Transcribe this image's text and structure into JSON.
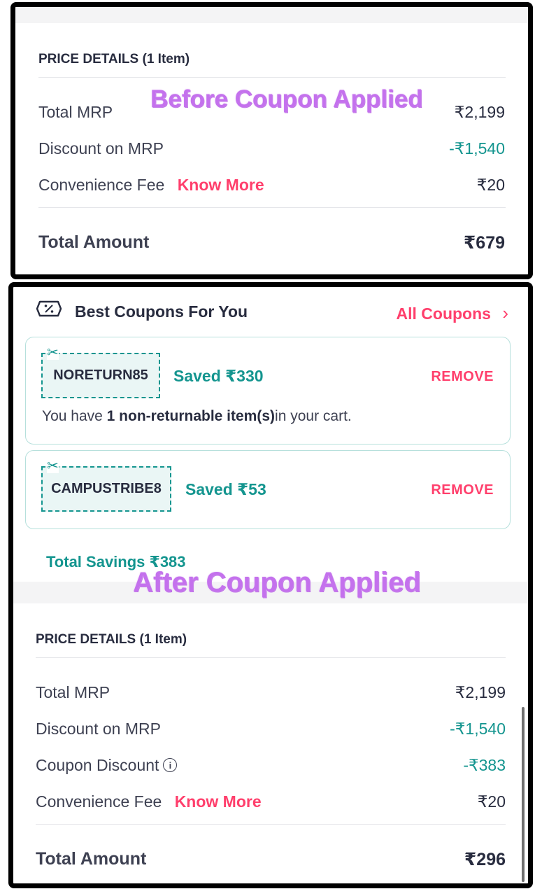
{
  "before": {
    "overlay": "Before Coupon Applied",
    "title": "PRICE DETAILS (1 Item)",
    "rows": [
      {
        "label": "Total MRP",
        "value": "₹2,199"
      },
      {
        "label": "Discount on MRP",
        "value": "-₹1,540"
      },
      {
        "label": "Convenience Fee",
        "link": "Know More",
        "value": "₹20"
      }
    ],
    "total_label": "Total Amount",
    "total_value": "₹679"
  },
  "coupons": {
    "header": "Best Coupons For You",
    "all_link": "All Coupons",
    "items": [
      {
        "code": "NORETURN85",
        "saved": "Saved ₹330",
        "action": "REMOVE",
        "note_pre": "You have ",
        "note_bold": "1 non-returnable item(s)",
        "note_post": "in your cart."
      },
      {
        "code": "CAMPUSTRIBE8",
        "saved": "Saved ₹53",
        "action": "REMOVE"
      }
    ],
    "total_savings": "Total Savings ₹383"
  },
  "after": {
    "overlay": "After Coupon Applied",
    "title": "PRICE DETAILS (1 Item)",
    "rows": [
      {
        "label": "Total MRP",
        "value": "₹2,199"
      },
      {
        "label": "Discount on MRP",
        "value": "-₹1,540"
      },
      {
        "label": "Coupon Discount",
        "value": "-₹383"
      },
      {
        "label": "Convenience Fee",
        "link": "Know More",
        "value": "₹20"
      }
    ],
    "total_label": "Total Amount",
    "total_value": "₹296"
  },
  "icons": {
    "scissors": "✂",
    "chevron": "›",
    "info": "i"
  },
  "colors": {
    "green": "#14958f",
    "pink": "#ff3f6c",
    "overlay": "#c471ed"
  }
}
